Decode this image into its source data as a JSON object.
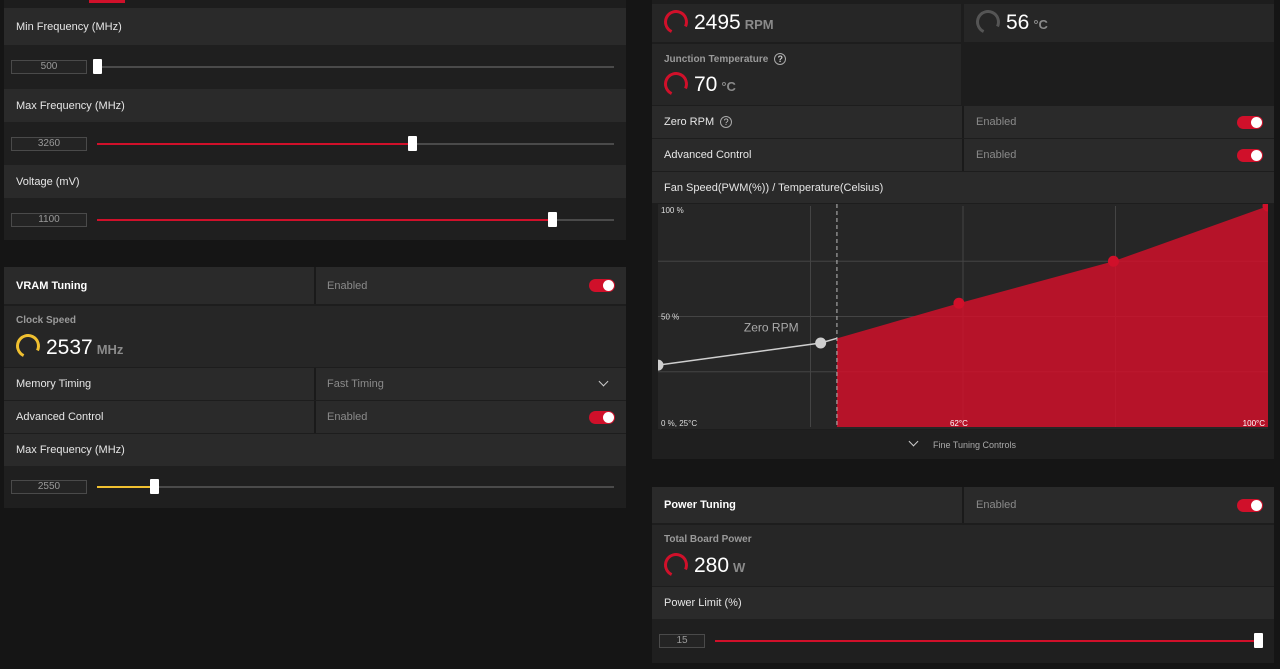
{
  "gpu_tuning": {
    "min_frequency": {
      "label": "Min Frequency (MHz)",
      "value": "500",
      "fraction": 0.0
    },
    "max_frequency": {
      "label": "Max Frequency (MHz)",
      "value": "3260",
      "fraction": 0.61
    },
    "voltage": {
      "label": "Voltage (mV)",
      "value": "1100",
      "fraction": 0.88
    }
  },
  "vram_tuning": {
    "title": "VRAM Tuning",
    "status": "Enabled",
    "clock_speed_label": "Clock Speed",
    "clock_speed_value": "2537",
    "clock_speed_unit": "MHz",
    "memory_timing_label": "Memory Timing",
    "memory_timing_value": "Fast Timing",
    "advanced_control_label": "Advanced Control",
    "advanced_control_value": "Enabled",
    "max_frequency": {
      "label": "Max Frequency (MHz)",
      "value": "2550",
      "fraction": 0.11
    }
  },
  "fan": {
    "speed_value": "2495",
    "speed_unit": "RPM",
    "temp_value": "56",
    "temp_unit": "°C",
    "junction_label": "Junction Temperature",
    "junction_value": "70",
    "junction_unit": "°C",
    "zero_rpm_label": "Zero RPM",
    "zero_rpm_value": "Enabled",
    "advanced_control_label": "Advanced Control",
    "advanced_control_value": "Enabled",
    "curve_title": "Fan Speed(PWM(%)) / Temperature(Celsius)",
    "fine_tuning_label": "Fine Tuning Controls"
  },
  "chart_data": {
    "type": "area",
    "x_unit": "°C",
    "y_unit": "%",
    "xlim": [
      25,
      100
    ],
    "ylim": [
      0,
      100
    ],
    "zero_rpm_threshold": 47,
    "zero_rpm_label": "Zero RPM",
    "tick_labels": {
      "y_top": "100 %",
      "y_mid": "50 %",
      "origin": "0 %, 25°C",
      "x_mid": "62°C",
      "x_max": "100°C"
    },
    "points": [
      {
        "x": 25,
        "y": 28
      },
      {
        "x": 45,
        "y": 38
      },
      {
        "x": 62,
        "y": 56
      },
      {
        "x": 81,
        "y": 75
      },
      {
        "x": 100,
        "y": 100
      }
    ],
    "grid": true
  },
  "power": {
    "title": "Power Tuning",
    "status": "Enabled",
    "total_board_power_label": "Total Board Power",
    "total_board_power_value": "280",
    "total_board_power_unit": "W",
    "power_limit": {
      "label": "Power Limit (%)",
      "value": "15",
      "fraction": 1.0
    }
  },
  "colors": {
    "accent": "#d0102a",
    "yellow": "#f0c030",
    "panel": "#2a2a2a",
    "background": "#151515"
  }
}
